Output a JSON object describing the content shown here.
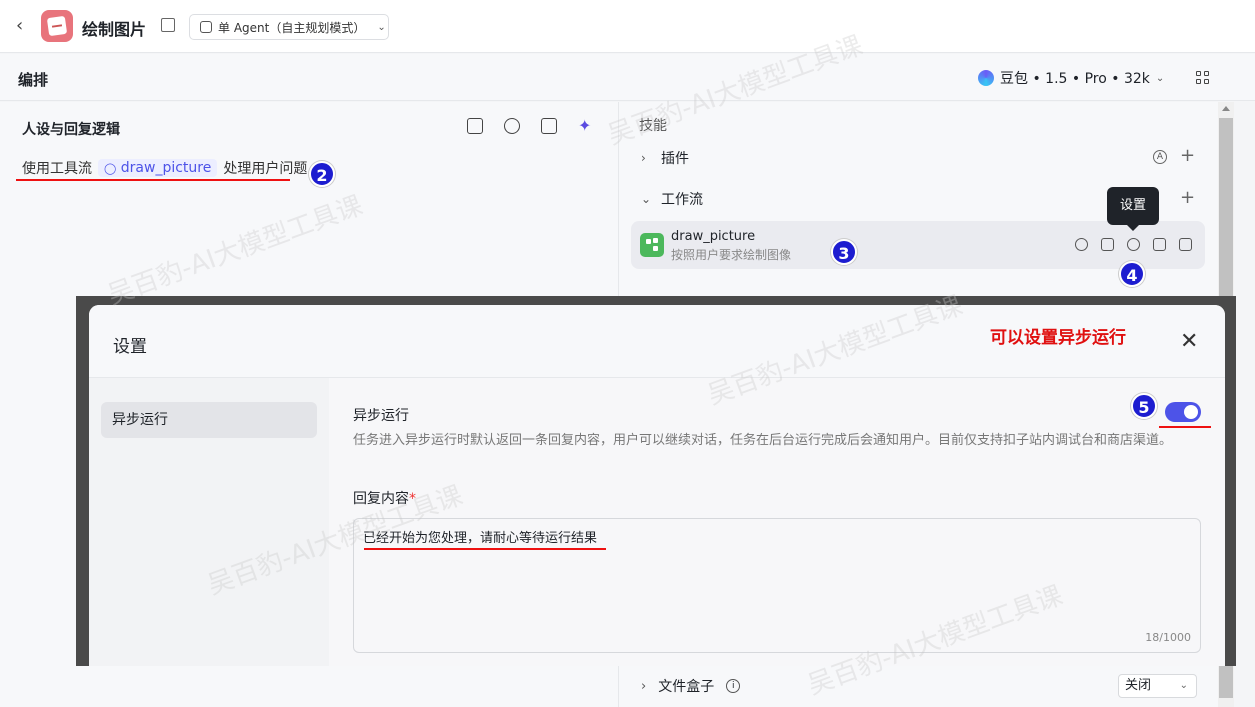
{
  "header": {
    "app_title": "绘制图片",
    "mode_label": "单 Agent（自主规划模式）"
  },
  "subbar": {
    "title": "编排",
    "model_label": "豆包 • 1.5 • Pro • 32k"
  },
  "left_panel": {
    "heading": "人设与回复逻辑",
    "prompt_prefix": "使用工具流",
    "workflow_chip": "draw_picture",
    "prompt_suffix": "处理用户问题"
  },
  "right_panel": {
    "skills_label": "技能",
    "plugins_label": "插件",
    "workflow_label": "工作流",
    "workflow_item": {
      "name": "draw_picture",
      "desc": "按照用户要求绘制图像"
    },
    "tooltip": "设置",
    "filebox_label": "文件盒子",
    "filebox_value": "关闭"
  },
  "modal": {
    "title": "设置",
    "note": "可以设置异步运行",
    "side_item": "异步运行",
    "async_title": "异步运行",
    "async_desc": "任务进入异步运行时默认返回一条回复内容，用户可以继续对话，任务在后台运行完成后会通知用户。目前仅支持扣子站内调试台和商店渠道。",
    "async_enabled": true,
    "reply_label": "回复内容",
    "reply_required": "*",
    "reply_value": "已经开始为您处理，请耐心等待运行结果",
    "reply_count": "18/1000"
  },
  "badges": [
    "2",
    "3",
    "4",
    "5"
  ],
  "watermark": "吴百豹-AI大模型工具课",
  "colors": {
    "accent": "#4d53e8",
    "badge": "#1d1dd0",
    "annotation_red": "#e01010"
  }
}
